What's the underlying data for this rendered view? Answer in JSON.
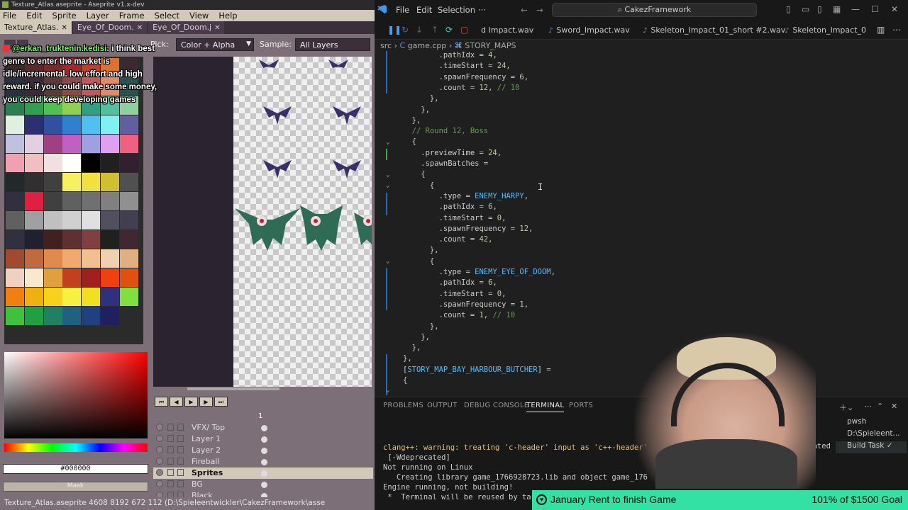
{
  "aseprite": {
    "window_title": "Texture_Atlas.aseprite - Aseprite v1.x-dev",
    "menu": [
      "File",
      "Edit",
      "Sprite",
      "Layer",
      "Frame",
      "Select",
      "View",
      "Help"
    ],
    "tabs": [
      "Texture_Atlas.",
      "Eye_Of_Doom.",
      "Eye_Of_Doom.j"
    ],
    "context_bar": {
      "pick_label": "Pick:",
      "pick_value": "Color + Alpha",
      "sample_label": "Sample:",
      "sample_value": "All Layers"
    },
    "palette_colors": [
      "#3b2a2a",
      "#5a2a2a",
      "#7a2a2a",
      "#a02a2a",
      "#c0402a",
      "#e07030",
      "#3a2a30",
      "#2a3040",
      "#3a2a3a",
      "#5a3a3a",
      "#8a4a4a",
      "#c05a5a",
      "#e08a6a",
      "#2a5050",
      "#2a8050",
      "#30a050",
      "#50c050",
      "#90d050",
      "#30a080",
      "#50c0a0",
      "#90d0a0",
      "#e0f0e0",
      "#2a3070",
      "#3050a0",
      "#3080d0",
      "#50c0f0",
      "#80f0f0",
      "#6060a0",
      "#c0c0e0",
      "#e0d0e0",
      "#a04080",
      "#c060c0",
      "#a0a0e0",
      "#e0a0f0",
      "#f06080",
      "#f0a0b0",
      "#f0c0c0",
      "#f0e0e0",
      "#ffffff",
      "#000000",
      "#202020",
      "#302030",
      "#202a2a",
      "#303030",
      "#404040",
      "#f8f060",
      "#f0e040",
      "#d0c030",
      "#505050",
      "#303040",
      "#e02040",
      "#404040",
      "#606060",
      "#707070",
      "#808080",
      "#909090",
      "#606060",
      "#a0a0a0",
      "#c0c0c0",
      "#d0d0d0",
      "#e0e0e0",
      "#505060",
      "#404050",
      "#303040",
      "#202030",
      "#402020",
      "#603030",
      "#804040",
      "#202020",
      "#402830",
      "#a04a30",
      "#c06a40",
      "#e08a50",
      "#f0aa70",
      "#f0c090",
      "#f0d0b0",
      "#e0b080",
      "#f0d0c0",
      "#f8e8d0",
      "#e0a040",
      "#c04020",
      "#a02020",
      "#f04010",
      "#e05010",
      "#f08010",
      "#f0b010",
      "#f8d020",
      "#f8f040",
      "#f0e020",
      "#303080",
      "#80e040",
      "#40c040",
      "#20a040",
      "#208060",
      "#206080",
      "#204080",
      "#202060"
    ],
    "hex_value": "#000000",
    "mask_label": "Mask",
    "timeline": {
      "frame_number": "1",
      "layers": [
        {
          "name": "VFX/ Top",
          "active": false
        },
        {
          "name": "Layer 1",
          "active": false
        },
        {
          "name": "Layer 2",
          "active": false
        },
        {
          "name": "Fireball",
          "active": false
        },
        {
          "name": "Sprites",
          "active": true
        },
        {
          "name": "BG",
          "active": false
        },
        {
          "name": "Black Background",
          "active": false
        }
      ]
    },
    "status": "Texture_Atlas.aseprite   4608 8192   672 112   (D:\\Spieleentwickler\\CakezFramework\\asse"
  },
  "chat": {
    "user": "@erkan_truktenin.kedisi",
    "message": ": i think best genre to enter the market is idle/incremental. low effort and high reward. if you could make some money, you could keep developing games"
  },
  "vscode": {
    "menu": [
      "File",
      "Edit",
      "Selection",
      "···"
    ],
    "command_center": "CakezFramework",
    "tabs": [
      "d Impact.wav",
      "Sword_Impact.wav",
      "Skeleton_Impact_01_short #2.wav",
      "Skeleton_Impact_0"
    ],
    "breadcrumb": [
      "src",
      "game.cpp",
      "STORY_MAPS"
    ],
    "code_lines": [
      "        .pathIdx = 4,",
      "        .timeStart = 24,",
      "        .spawnFrequency = 6,",
      "        .count = 12, // 10",
      "      },",
      "    },",
      "  },",
      "  // Round 12, Boss",
      "  {",
      "    .previewTime = 24,",
      "    .spawnBatches =",
      "    {",
      "      {",
      "        .type = ENEMY_HARPY,",
      "        .pathIdx = 6,",
      "        .timeStart = 0,",
      "        .spawnFrequency = 12,",
      "        .count = 42,",
      "      },",
      "      {",
      "        .type = ENEMY_EYE_OF_DOOM,",
      "        .pathIdx = 6,",
      "        .timeStart = 0,",
      "        .spawnFrequency = 1,",
      "        .count = 1, // 10",
      "      },",
      "    },",
      "  },",
      "},",
      "[STORY_MAP_BAY_HARBOUR_BUTCHER] =",
      "{"
    ],
    "panel_tabs": [
      "PROBLEMS",
      "OUTPUT",
      "DEBUG CONSOLE",
      "TERMINAL",
      "PORTS"
    ],
    "terminal_lines": [
      "clang++: warning: treating 'c-header' input as 'c++-header'",
      " [-Wdeprecated]",
      "Not running on Linux",
      "   Creating library game_1766928723.lib and object game_176",
      "Engine running, not building!",
      " *  Terminal will be reused by tas"
    ],
    "terminal_list": [
      "pwsh",
      "D:\\Spieleent...",
      "Build  Task"
    ],
    "deprecated_fragment": "eprecated"
  },
  "goal": {
    "title": "January Rent to finish Game",
    "amount": "101% of $1500 Goal"
  }
}
